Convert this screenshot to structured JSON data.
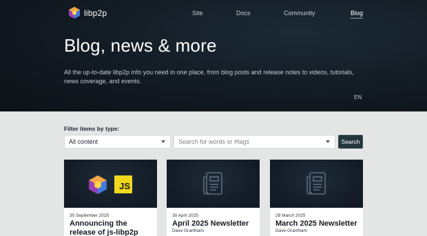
{
  "brand": {
    "name": "libp2p"
  },
  "nav": {
    "items": [
      {
        "label": "Site"
      },
      {
        "label": "Docs"
      },
      {
        "label": "Community"
      },
      {
        "label": "Blog"
      }
    ],
    "active": "Blog"
  },
  "hero": {
    "title": "Blog, news & more",
    "subtitle": "All the up-to-date libp2p info you need in one place, from blog posts and release notes to videos, tutorials, news coverage, and events.",
    "language": "EN"
  },
  "filter": {
    "label": "Filter items by type:",
    "type_value": "All content",
    "search_placeholder": "Search for words or #tags",
    "search_button": "Search"
  },
  "cards": [
    {
      "date": "30 September 2025",
      "title": "Announcing the release of js-libp2p",
      "author": "",
      "image": "libp2p-js-logo",
      "badge_text": "JS"
    },
    {
      "date": "30 April 2025",
      "title": "April 2025 Newsletter",
      "author": "Dave Grantham",
      "image": "newspaper-icon"
    },
    {
      "date": "28 March 2025",
      "title": "March 2025 Newsletter",
      "author": "Dave Grantham",
      "image": "newspaper-icon"
    }
  ],
  "colors": {
    "hero_bg": "#121a22",
    "accent_button": "#23363d",
    "js_yellow": "#f0d81c",
    "page_bg": "#e4e6e6"
  }
}
